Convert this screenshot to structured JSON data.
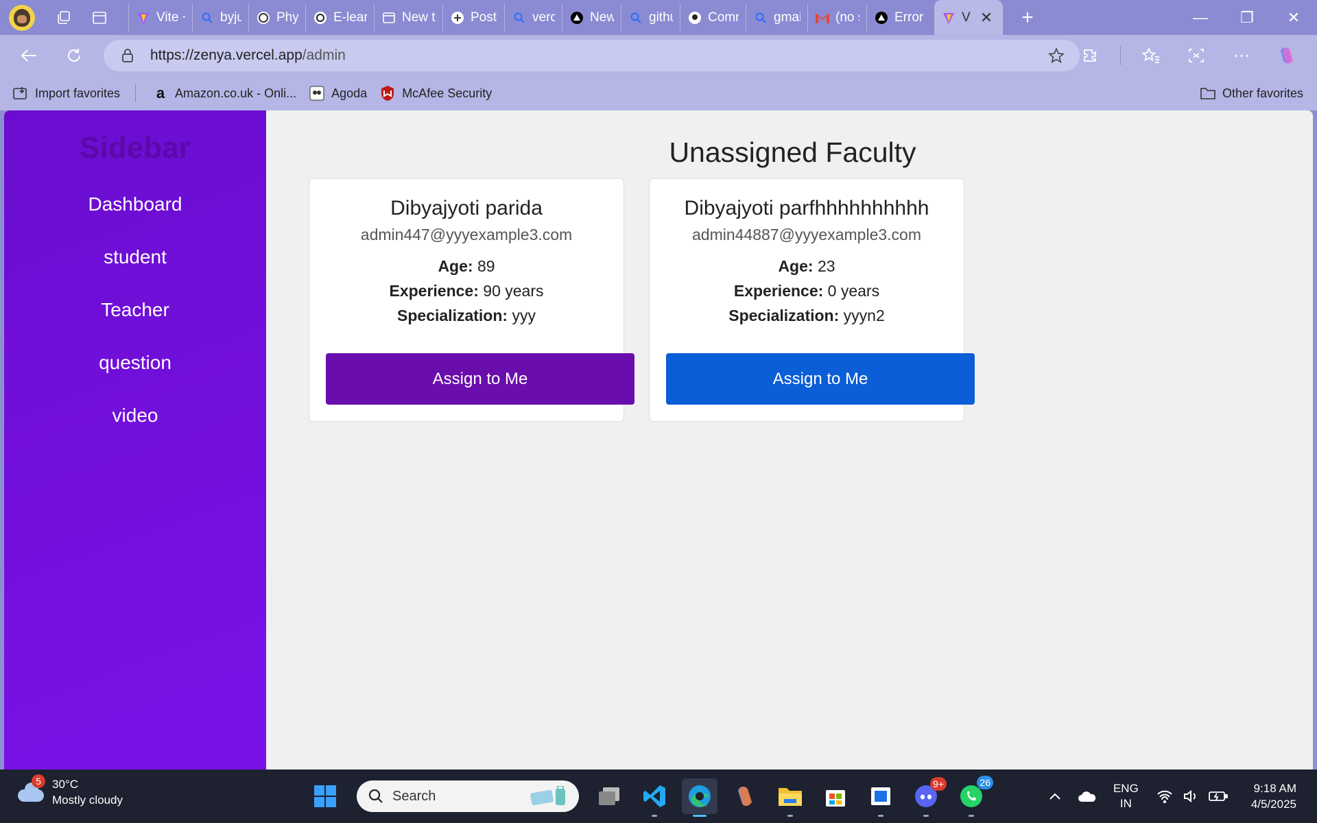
{
  "browser": {
    "tabs": [
      {
        "title": "Vite +",
        "icon": "vite-icon"
      },
      {
        "title": "byju's",
        "icon": "search-icon"
      },
      {
        "title": "Physic",
        "icon": "wordpress-icon"
      },
      {
        "title": "E-lear",
        "icon": "openai-icon"
      },
      {
        "title": "New t",
        "icon": "newtab-icon"
      },
      {
        "title": "Postgr",
        "icon": "postgres-icon"
      },
      {
        "title": "vercel",
        "icon": "search-icon"
      },
      {
        "title": "New P",
        "icon": "vercel-icon"
      },
      {
        "title": "githul",
        "icon": "search-icon"
      },
      {
        "title": "Comn",
        "icon": "github-icon"
      },
      {
        "title": "gmail",
        "icon": "search-icon"
      },
      {
        "title": "(no su",
        "icon": "gmail-icon"
      },
      {
        "title": "Error",
        "icon": "vercel-icon"
      },
      {
        "title": "V",
        "icon": "vite-icon",
        "active": true
      }
    ],
    "url_host": "https://zenya.vercel.app",
    "url_path": "/admin",
    "favorites": [
      {
        "label": "Import favorites",
        "icon": "import-icon"
      },
      {
        "label": "Amazon.co.uk - Onli...",
        "icon": "amazon-icon"
      },
      {
        "label": "Agoda",
        "icon": "agoda-icon"
      },
      {
        "label": "McAfee Security",
        "icon": "mcafee-icon"
      }
    ],
    "other_favorites": "Other favorites"
  },
  "sidebar": {
    "title": "Sidebar",
    "items": [
      "Dashboard",
      "student",
      "Teacher",
      "question",
      "video"
    ]
  },
  "main": {
    "heading": "Unassigned Faculty",
    "labels": {
      "age": "Age:",
      "experience": "Experience:",
      "specialization": "Specialization:"
    },
    "cards": [
      {
        "name": "Dibyajyoti parida",
        "email": "admin447@yyyexample3.com",
        "age": "89",
        "experience": "90 years",
        "specialization": "yyy",
        "button": "Assign to Me",
        "button_color": "#6a0dad"
      },
      {
        "name": "Dibyajyoti parfhhhhhhhhhh",
        "email": "admin44887@yyyexample3.com",
        "age": "23",
        "experience": "0 years",
        "specialization": "yyyn2",
        "button": "Assign to Me",
        "button_color": "#0b5ed7"
      }
    ]
  },
  "taskbar": {
    "weather_badge": "5",
    "temperature": "30°C",
    "condition": "Mostly cloudy",
    "search_placeholder": "Search",
    "discord_badge": "9+",
    "whatsapp_badge": "26",
    "lang_top": "ENG",
    "lang_bottom": "IN",
    "time": "9:18 AM",
    "date": "4/5/2025"
  },
  "colors": {
    "sidebar": "#7a12e8",
    "purple_button": "#6a0dad",
    "blue_button": "#0b5ed7",
    "browser_frame": "#8a8bd2"
  }
}
